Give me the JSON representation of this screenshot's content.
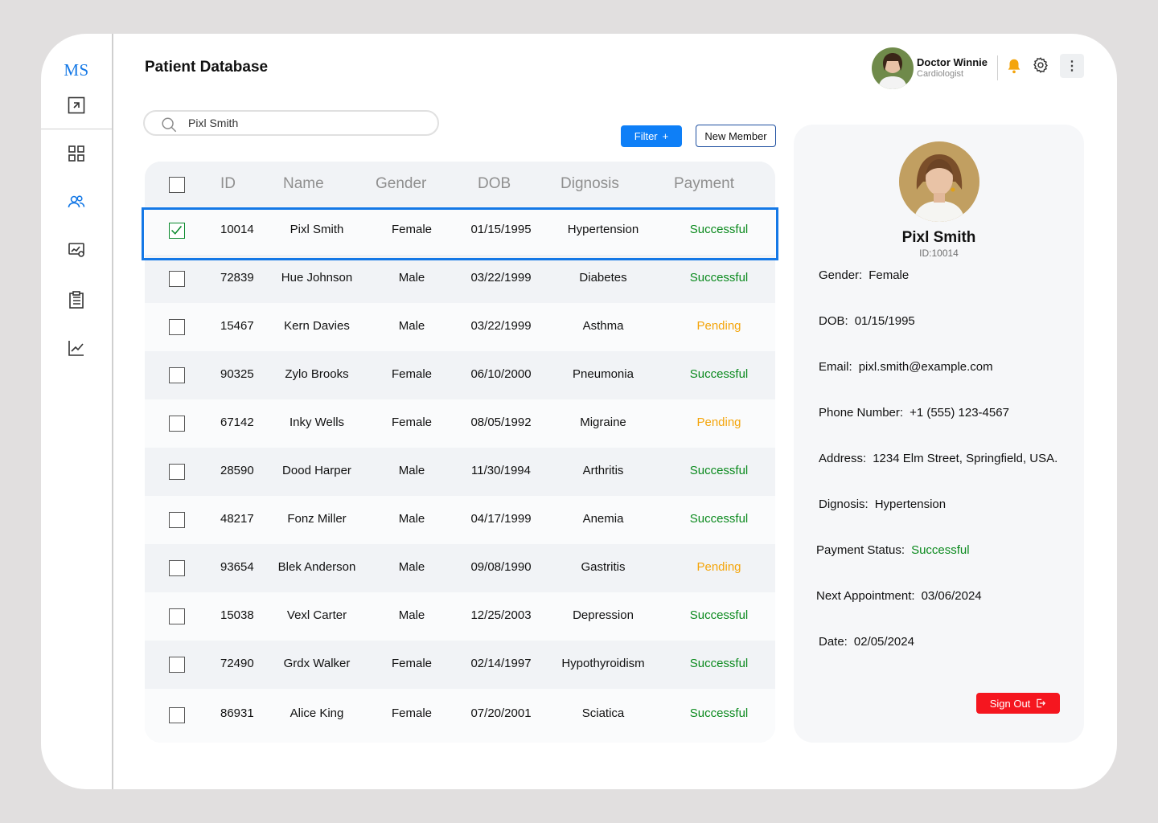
{
  "brand": {
    "logo": "MS"
  },
  "header": {
    "title": "Patient Database",
    "doctor_name": "Doctor Winnie",
    "doctor_role": "Cardiologist"
  },
  "search": {
    "value": "Pixl Smith"
  },
  "toolbar": {
    "filter_label": "Filter",
    "filter_icon": "+",
    "new_member_label": "New Member"
  },
  "table": {
    "columns": [
      "ID",
      "Name",
      "Gender",
      "DOB",
      "Dignosis",
      "Payment"
    ],
    "selected_index": 0,
    "rows": [
      {
        "id": "10014",
        "name": "Pixl Smith",
        "gender": "Female",
        "dob": "01/15/1995",
        "diagnosis": "Hypertension",
        "payment": "Successful"
      },
      {
        "id": "72839",
        "name": "Hue Johnson",
        "gender": "Male",
        "dob": "03/22/1999",
        "diagnosis": "Diabetes",
        "payment": "Successful"
      },
      {
        "id": "15467",
        "name": "Kern Davies",
        "gender": "Male",
        "dob": "03/22/1999",
        "diagnosis": "Asthma",
        "payment": "Pending"
      },
      {
        "id": "90325",
        "name": "Zylo Brooks",
        "gender": "Female",
        "dob": "06/10/2000",
        "diagnosis": "Pneumonia",
        "payment": "Successful"
      },
      {
        "id": "67142",
        "name": "Inky Wells",
        "gender": "Female",
        "dob": "08/05/1992",
        "diagnosis": "Migraine",
        "payment": "Pending"
      },
      {
        "id": "28590",
        "name": "Dood Harper",
        "gender": "Male",
        "dob": "11/30/1994",
        "diagnosis": "Arthritis",
        "payment": "Successful"
      },
      {
        "id": "48217",
        "name": "Fonz Miller",
        "gender": "Male",
        "dob": "04/17/1999",
        "diagnosis": "Anemia",
        "payment": "Successful"
      },
      {
        "id": "93654",
        "name": "Blek Anderson",
        "gender": "Male",
        "dob": "09/08/1990",
        "diagnosis": "Gastritis",
        "payment": "Pending"
      },
      {
        "id": "15038",
        "name": "Vexl Carter",
        "gender": "Male",
        "dob": "12/25/2003",
        "diagnosis": "Depression",
        "payment": "Successful"
      },
      {
        "id": "72490",
        "name": "Grdx Walker",
        "gender": "Female",
        "dob": "02/14/1997",
        "diagnosis": "Hypothyroidism",
        "payment": "Successful"
      },
      {
        "id": "86931",
        "name": "Alice King",
        "gender": "Female",
        "dob": "07/20/2001",
        "diagnosis": "Sciatica",
        "payment": "Successful"
      }
    ]
  },
  "details": {
    "name": "Pixl Smith",
    "id_text": "ID:10014",
    "fields": [
      {
        "label": "Gender:",
        "value": "Female"
      },
      {
        "label": "DOB:",
        "value": "01/15/1995"
      },
      {
        "label": "Email:",
        "value": "pixl.smith@example.com"
      },
      {
        "label": "Phone Number:",
        "value": "+1  (555)  123-4567"
      },
      {
        "label": "Address:",
        "value": "1234 Elm Street, Springfield, USA."
      },
      {
        "label": "Dignosis:",
        "value": "Hypertension"
      },
      {
        "label": "Payment Status:",
        "value": "Successful"
      },
      {
        "label": "Next Appointment:",
        "value": "03/06/2024"
      },
      {
        "label": "Date:",
        "value": "02/05/2024"
      }
    ],
    "signout_label": "Sign Out"
  },
  "colors": {
    "accent": "#1478e6",
    "success": "#0b8a1e",
    "pending": "#f4a50b",
    "danger": "#f5161f"
  }
}
